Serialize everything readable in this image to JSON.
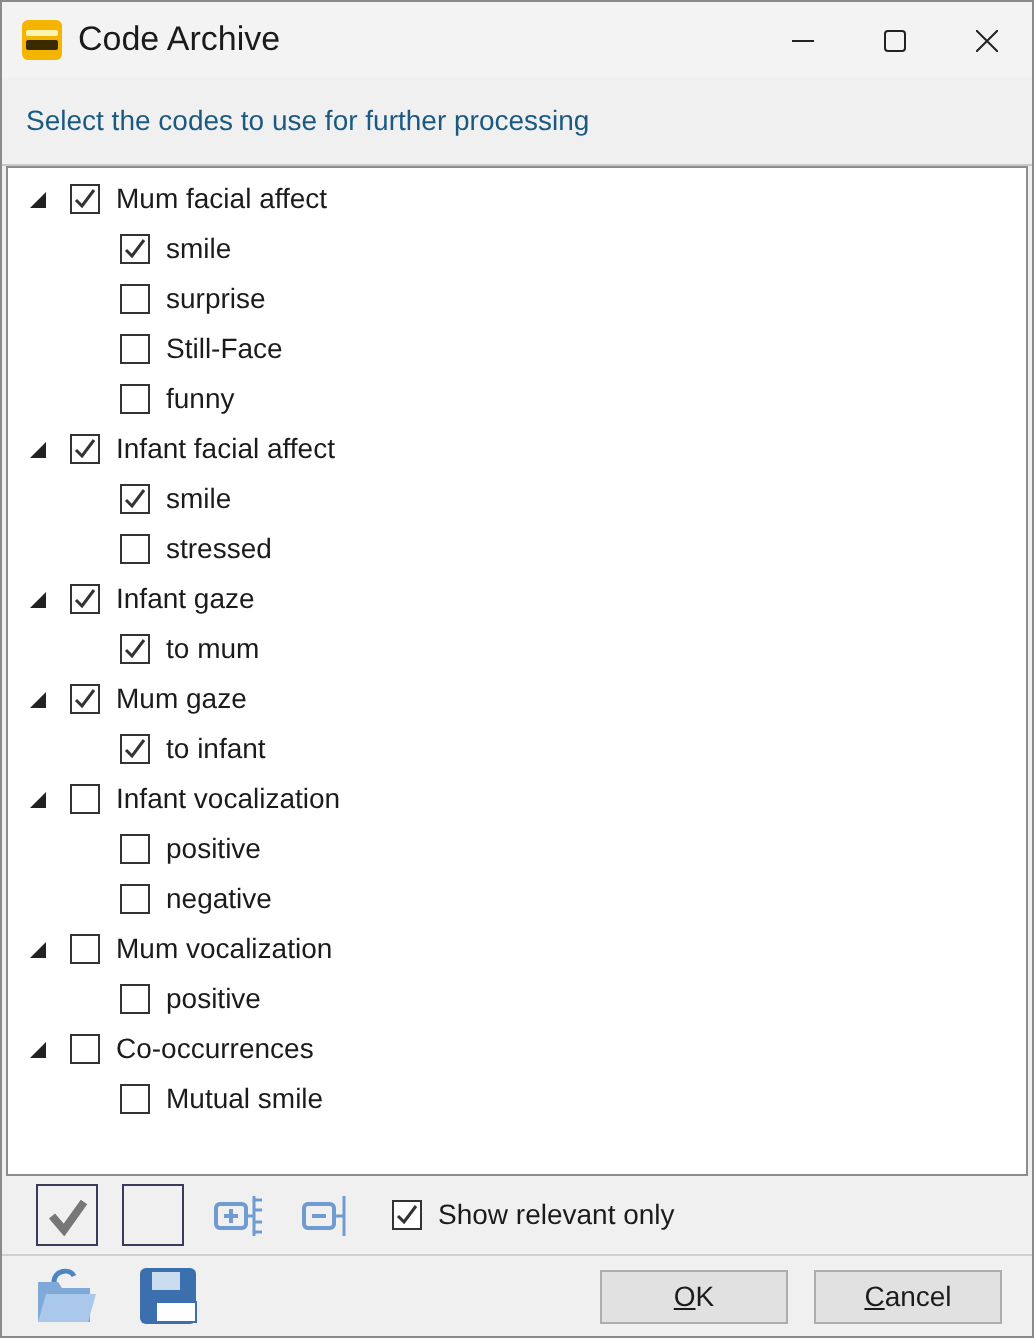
{
  "window": {
    "title": "Code Archive"
  },
  "instruction": "Select the codes to use for further processing",
  "tree": [
    {
      "label": "Mum facial affect",
      "checked": true,
      "expanded": true,
      "children": [
        {
          "label": "smile",
          "checked": true
        },
        {
          "label": "surprise",
          "checked": false
        },
        {
          "label": "Still-Face",
          "checked": false
        },
        {
          "label": "funny",
          "checked": false
        }
      ]
    },
    {
      "label": "Infant facial affect",
      "checked": true,
      "expanded": true,
      "children": [
        {
          "label": "smile",
          "checked": true
        },
        {
          "label": "stressed",
          "checked": false
        }
      ]
    },
    {
      "label": "Infant gaze",
      "checked": true,
      "expanded": true,
      "children": [
        {
          "label": "to mum",
          "checked": true
        }
      ]
    },
    {
      "label": "Mum gaze",
      "checked": true,
      "expanded": true,
      "children": [
        {
          "label": "to infant",
          "checked": true
        }
      ]
    },
    {
      "label": "Infant vocalization",
      "checked": false,
      "expanded": true,
      "children": [
        {
          "label": "positive",
          "checked": false
        },
        {
          "label": "negative",
          "checked": false
        }
      ]
    },
    {
      "label": "Mum vocalization",
      "checked": false,
      "expanded": true,
      "children": [
        {
          "label": "positive",
          "checked": false
        }
      ]
    },
    {
      "label": "Co-occurrences",
      "checked": false,
      "expanded": true,
      "children": [
        {
          "label": "Mutual smile",
          "checked": false
        }
      ]
    }
  ],
  "show_relevant_only": {
    "label": "Show relevant only",
    "checked": true
  },
  "buttons": [
    {
      "label": "OK"
    },
    {
      "label": "Cancel"
    }
  ]
}
